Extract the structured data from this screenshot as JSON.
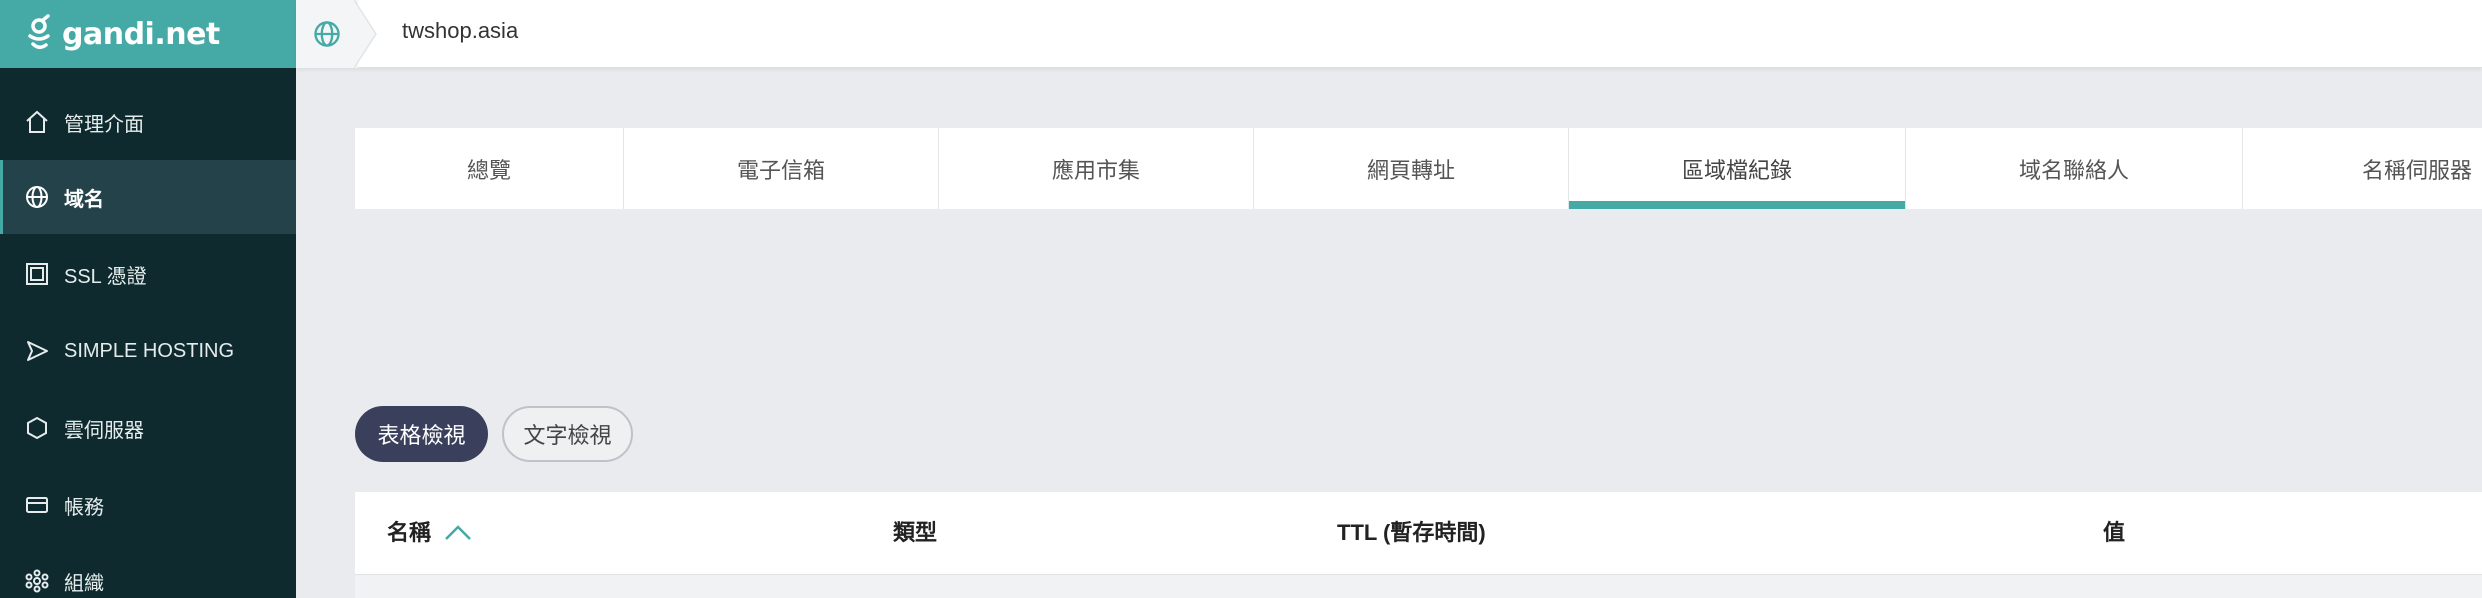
{
  "brand": {
    "name": "gandi.net",
    "accent": "#45aaa6",
    "sidebar_bg": "#0e2a2e"
  },
  "sidebar": {
    "items": [
      {
        "label": "管理介面",
        "icon": "home-icon"
      },
      {
        "label": "域名",
        "icon": "globe-icon",
        "active": true
      },
      {
        "label": "SSL 憑證",
        "icon": "certificate-icon"
      },
      {
        "label": "SIMPLE HOSTING",
        "icon": "send-icon"
      },
      {
        "label": "雲伺服器",
        "icon": "cloud-server-icon"
      },
      {
        "label": "帳務",
        "icon": "credit-card-icon"
      },
      {
        "label": "組織",
        "icon": "organization-icon"
      }
    ]
  },
  "topbar": {
    "domain": "twshop.asia"
  },
  "tabs": [
    {
      "label": "總覽"
    },
    {
      "label": "電子信箱"
    },
    {
      "label": "應用市集"
    },
    {
      "label": "網頁轉址"
    },
    {
      "label": "區域檔紀錄",
      "active": true
    },
    {
      "label": "域名聯絡人"
    },
    {
      "label": "名稱伺服器"
    }
  ],
  "view_toggle": {
    "table_view": "表格檢視",
    "text_view": "文字檢視"
  },
  "table": {
    "columns": [
      "名稱",
      "類型",
      "TTL (暫存時間)",
      "值"
    ],
    "sorted_column": "名稱",
    "sort_direction": "ascending"
  }
}
